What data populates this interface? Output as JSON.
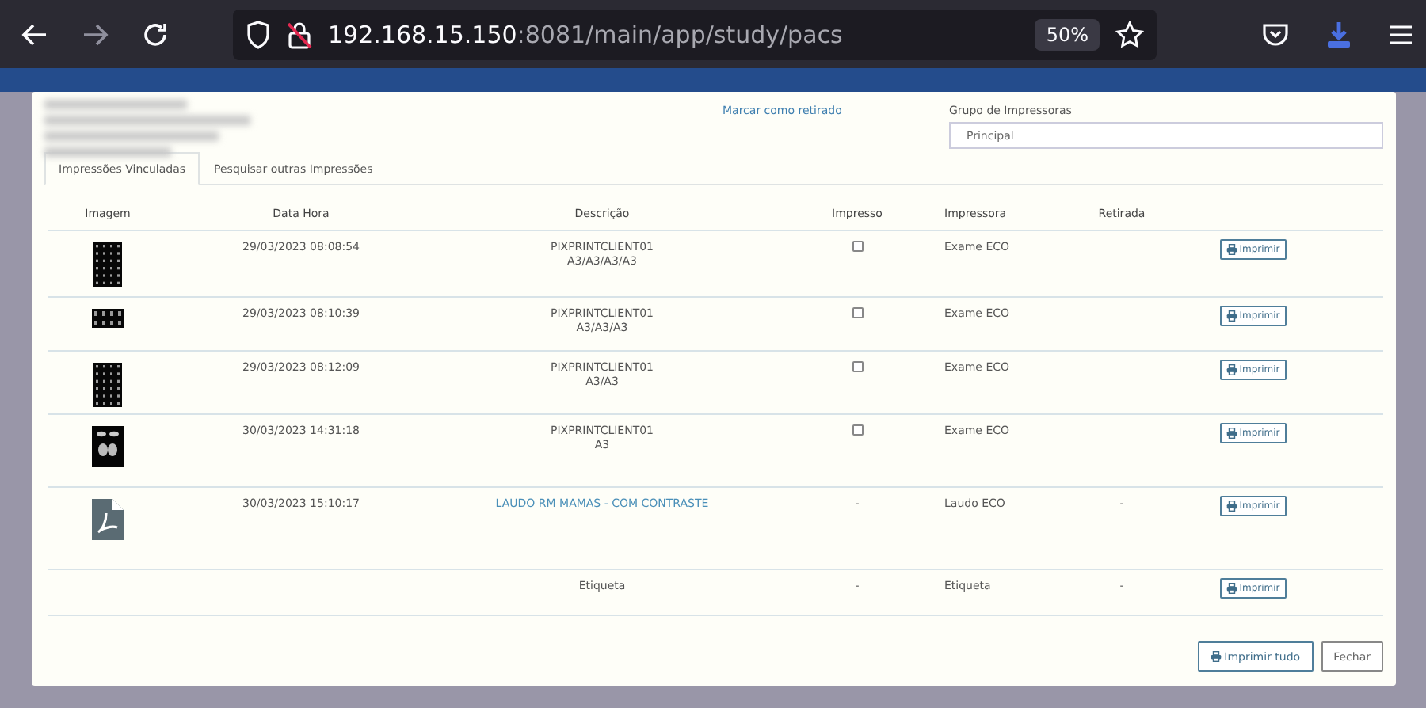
{
  "browser": {
    "url_host": "192.168.15.150",
    "url_path": ":8081/main/app/study/pacs",
    "zoom": "50%"
  },
  "dialog": {
    "mark_link": "Marcar como retirado",
    "printer_group": {
      "label": "Grupo de Impressoras",
      "value": "Principal"
    },
    "tabs": [
      {
        "label": "Impressões Vinculadas",
        "selected": true
      },
      {
        "label": "Pesquisar outras Impressões",
        "selected": false
      }
    ],
    "table": {
      "columns": [
        "Imagem",
        "Data Hora",
        "Descrição",
        "Impresso",
        "Impressora",
        "Retirada"
      ],
      "rows": [
        {
          "date": "29/03/2023 08:08:54",
          "description": {
            "kind": "text",
            "lines": [
              "PIXPRINTCLIENT01",
              "A3/A3/A3/A3"
            ]
          },
          "printed": {
            "kind": "checkbox",
            "checked": false
          },
          "printer": "Exame ECO",
          "action": "Imprimir"
        },
        {
          "date": "29/03/2023 08:10:39",
          "description": {
            "kind": "text",
            "lines": [
              "PIXPRINTCLIENT01",
              "A3/A3/A3"
            ]
          },
          "printed": {
            "kind": "checkbox",
            "checked": false
          },
          "printer": "Exame ECO",
          "action": "Imprimir"
        },
        {
          "date": "29/03/2023 08:12:09",
          "description": {
            "kind": "text",
            "lines": [
              "PIXPRINTCLIENT01",
              "A3/A3"
            ]
          },
          "printed": {
            "kind": "checkbox",
            "checked": false
          },
          "printer": "Exame ECO",
          "action": "Imprimir"
        },
        {
          "date": "30/03/2023 14:31:18",
          "description": {
            "kind": "text",
            "lines": [
              "PIXPRINTCLIENT01",
              "A3"
            ]
          },
          "printed": {
            "kind": "checkbox",
            "checked": false
          },
          "printer": "Exame ECO",
          "action": "Imprimir"
        },
        {
          "image": {
            "kind": "pdf"
          },
          "date": "30/03/2023 15:10:17",
          "description": {
            "kind": "link",
            "lines": [
              "LAUDO RM MAMAS - COM CONTRASTE"
            ]
          },
          "printed": {
            "kind": "text",
            "text": "-"
          },
          "printer": "Laudo ECO",
          "removed": "-",
          "action": "Imprimir"
        },
        {
          "description": {
            "kind": "text",
            "lines": [
              "Etiqueta"
            ]
          },
          "printed": {
            "kind": "text",
            "text": "-"
          },
          "printer": "Etiqueta",
          "removed": "-",
          "action": "Imprimir"
        }
      ]
    },
    "buttons": [
      {
        "label": "Imprimir tudo",
        "kind": "print"
      },
      {
        "label": "Fechar",
        "kind": "plain"
      }
    ]
  }
}
